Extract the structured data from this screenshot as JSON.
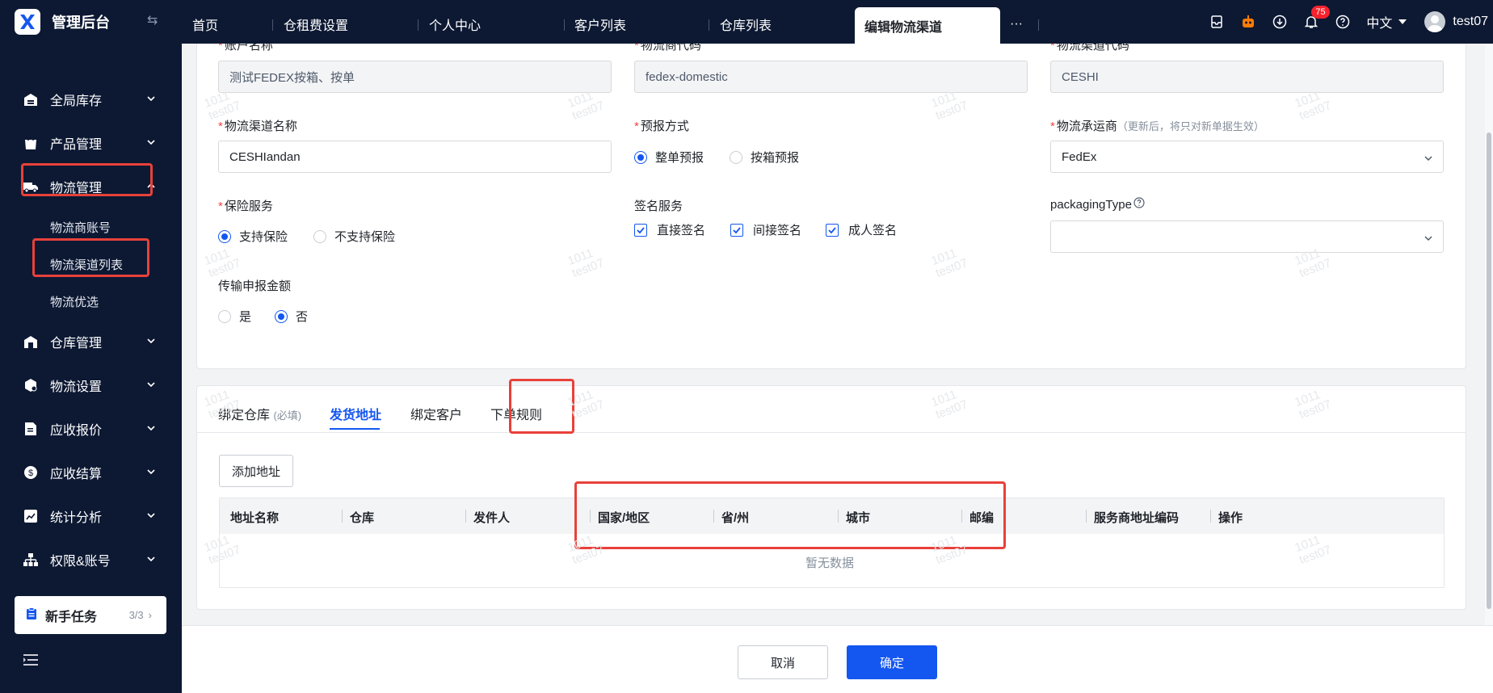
{
  "app": {
    "title": "管理后台",
    "logo_icon": "app-logo-icon"
  },
  "sidebar": {
    "items": [
      {
        "label": "全局库存",
        "icon": "warehouse-stock-icon"
      },
      {
        "label": "产品管理",
        "icon": "product-bag-icon"
      },
      {
        "label": "物流管理",
        "icon": "truck-icon"
      },
      {
        "label": "仓库管理",
        "icon": "warehouse-icon"
      },
      {
        "label": "物流设置",
        "icon": "logistics-settings-icon"
      },
      {
        "label": "应收报价",
        "icon": "quote-doc-icon"
      },
      {
        "label": "应收结算",
        "icon": "settlement-coin-icon"
      },
      {
        "label": "统计分析",
        "icon": "chart-icon"
      },
      {
        "label": "权限&账号",
        "icon": "org-tree-icon"
      }
    ],
    "logistics_sub": [
      "物流商账号",
      "物流渠道列表",
      "物流优选"
    ],
    "task": {
      "label": "新手任务",
      "count": "3/3"
    }
  },
  "topbar": {
    "tabs": [
      "首页",
      "仓租费设置",
      "个人中心",
      "客户列表",
      "仓库列表",
      "编辑物流渠道"
    ],
    "more": "···",
    "badge": "75",
    "lang": "中文",
    "user": "test07"
  },
  "form": {
    "account_name": {
      "label": "账户名称",
      "value": "测试FEDEX按箱、按单"
    },
    "provider_code": {
      "label": "物流商代码",
      "value": "fedex-domestic"
    },
    "channel_code": {
      "label": "物流渠道代码",
      "value": "CESHI"
    },
    "channel_name": {
      "label": "物流渠道名称",
      "value": "CESHIandan"
    },
    "forecast": {
      "label": "预报方式",
      "options": [
        "整单预报",
        "按箱预报"
      ],
      "selected": "整单预报"
    },
    "carrier": {
      "label": "物流承运商",
      "hint": "（更新后，将只对新单据生效）",
      "value": "FedEx"
    },
    "insurance": {
      "label": "保险服务",
      "options": [
        "支持保险",
        "不支持保险"
      ],
      "selected": "支持保险"
    },
    "signature": {
      "label": "签名服务",
      "options": [
        "直接签名",
        "间接签名",
        "成人签名"
      ]
    },
    "packaging": {
      "label": "packagingType",
      "value": ""
    },
    "declare": {
      "label": "传输申报金额",
      "options": [
        "是",
        "否"
      ],
      "selected": "否"
    }
  },
  "subtabs": {
    "items": [
      "绑定仓库",
      "发货地址",
      "绑定客户",
      "下单规则"
    ],
    "warehouse_hint": "(必填)",
    "active": "发货地址"
  },
  "address": {
    "add_button": "添加地址",
    "columns": [
      "地址名称",
      "仓库",
      "发件人",
      "国家/地区",
      "省/州",
      "城市",
      "邮编",
      "服务商地址编码",
      "操作"
    ],
    "empty": "暂无数据"
  },
  "footer": {
    "cancel": "取消",
    "ok": "确定"
  },
  "watermark": {
    "line1": "1011",
    "line2": "test07"
  },
  "colors": {
    "sidebar_bg": "#0d1933",
    "primary": "#1456f0",
    "highlight": "#e8413a",
    "required": "#f53f3f"
  }
}
